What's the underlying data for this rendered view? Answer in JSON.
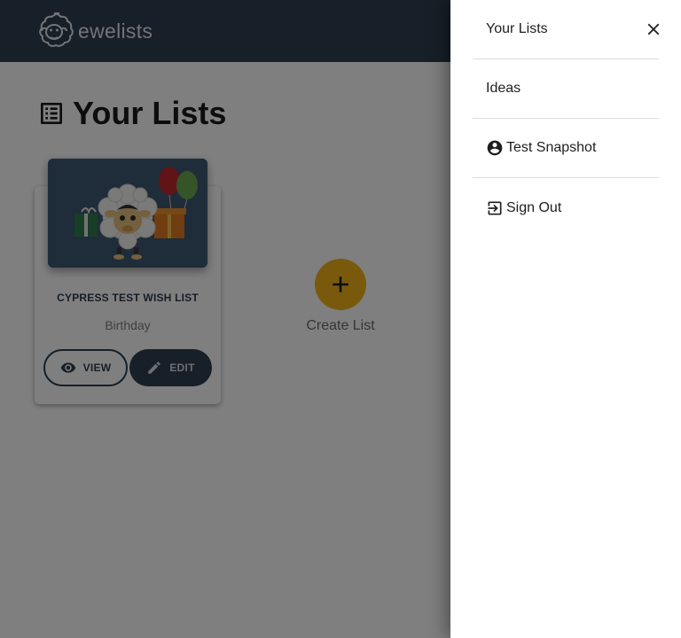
{
  "app": {
    "brand_name": "ewelists"
  },
  "page": {
    "title": "Your Lists"
  },
  "lists": [
    {
      "title": "CYPRESS TEST WISH LIST",
      "occasion": "Birthday",
      "view_label": "VIEW",
      "edit_label": "EDIT"
    }
  ],
  "create_list": {
    "label": "Create List"
  },
  "drawer": {
    "items": [
      {
        "label": "Your Lists"
      },
      {
        "label": "Ideas"
      },
      {
        "label": "Test Snapshot",
        "icon": "account-circle-icon"
      },
      {
        "label": "Sign Out",
        "icon": "sign-out-icon"
      }
    ]
  },
  "colors": {
    "appbar": "#2f3e50",
    "accent": "#f3b41b",
    "primary": "#2f3e50"
  }
}
